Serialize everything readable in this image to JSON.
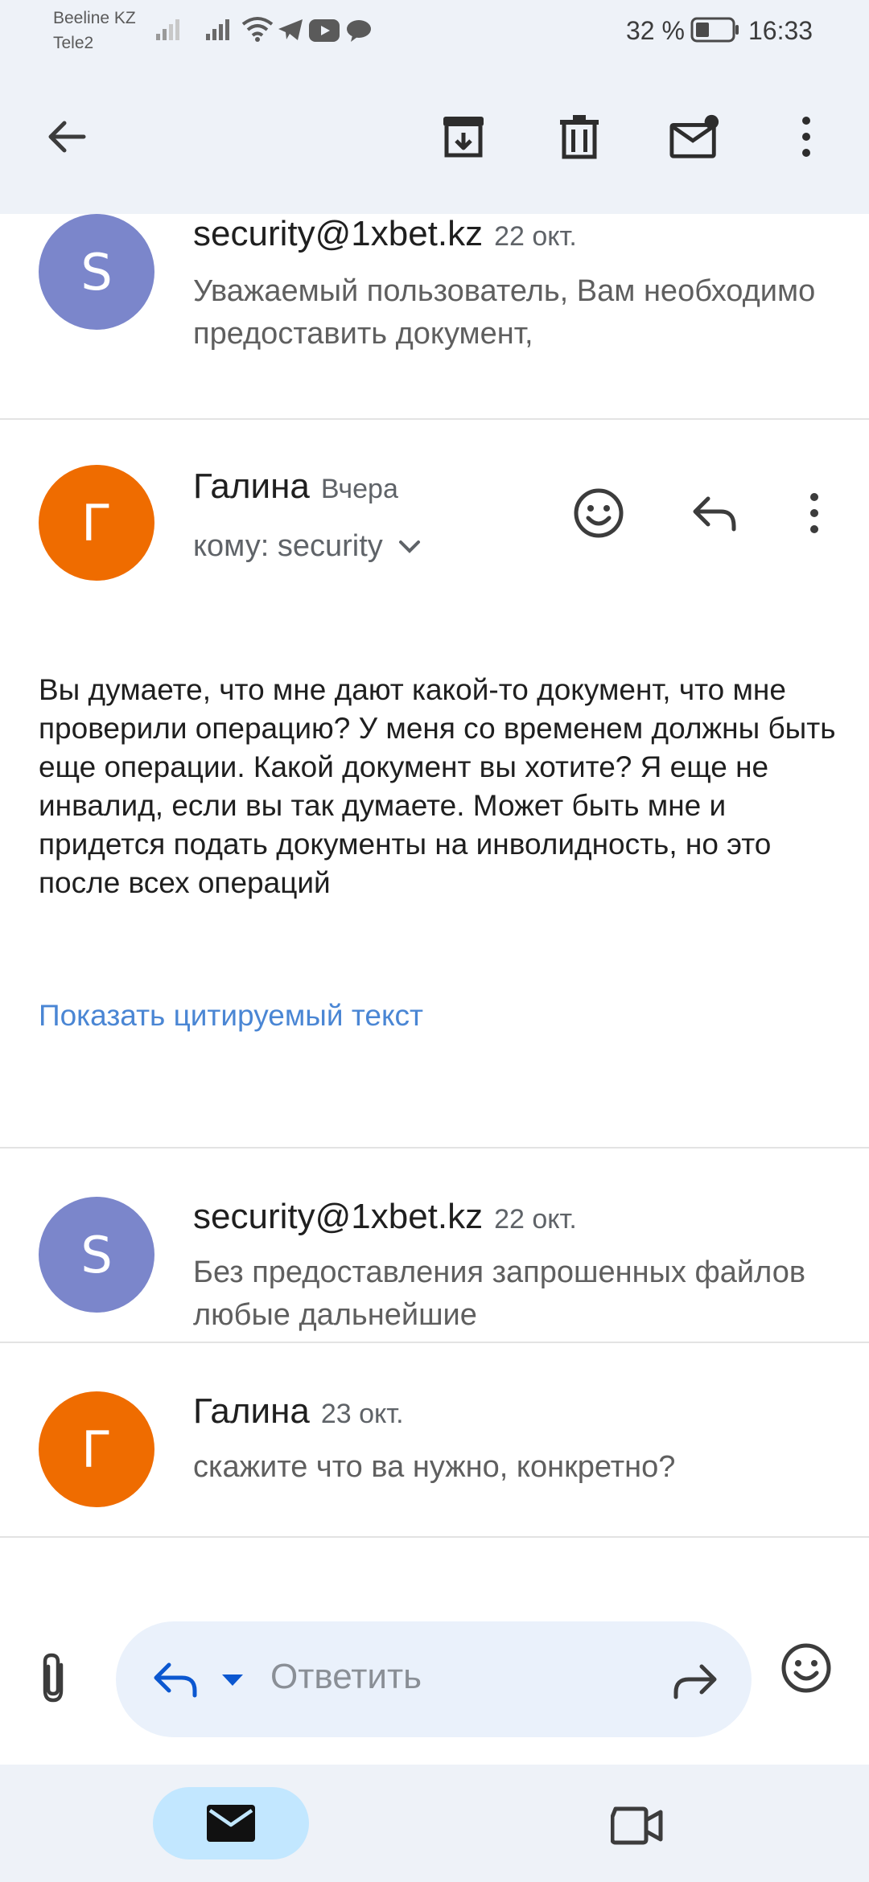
{
  "status_bar": {
    "carrier_1": "Beeline KZ",
    "carrier_2": "Tele2",
    "battery_percent": "32 %",
    "time": "16:33"
  },
  "app_bar": {
    "icons": [
      "back-arrow-icon",
      "archive-icon",
      "delete-icon",
      "mark-unread-icon",
      "more-vert-icon"
    ]
  },
  "messages": [
    {
      "avatar_letter": "S",
      "avatar_color": "#7b86cb",
      "sender": "security@1xbet.kz",
      "date": "22 окт.",
      "snippet": "Уважаемый пользователь, Вам необходимо предоставить документ,"
    },
    {
      "avatar_letter": "Г",
      "avatar_color": "#ef6c00",
      "sender": "Галина",
      "date": "Вчера",
      "recipient": "кому: security",
      "body": "Вы думаете, что мне дают какой-то документ, что мне проверили операцию? У меня со временем должны быть еще операции. Какой документ вы хотите? Я еще не инвалид, если вы так думаете. Может быть мне и придется подать документы на инволидность, но это после всех операций",
      "show_quoted": "Показать цитируемый текст"
    },
    {
      "avatar_letter": "S",
      "avatar_color": "#7b86cb",
      "sender": "security@1xbet.kz",
      "date": "22 окт.",
      "snippet": "Без предоставления запрошенных файлов любые дальнейшие"
    },
    {
      "avatar_letter": "Г",
      "avatar_color": "#ef6c00",
      "sender": "Галина",
      "date": "23 окт.",
      "snippet": "скажите что ва нужно, конкретно?"
    }
  ],
  "reply_bar": {
    "placeholder": "Ответить"
  },
  "bottom_nav": {
    "items": [
      "mail-icon",
      "video-call-icon"
    ],
    "active": "mail-icon"
  },
  "colors": {
    "top_background": "#eef2f8",
    "link": "#4a86d4",
    "accent_blue": "#0b57d0",
    "active_nav": "#c2e7ff"
  }
}
